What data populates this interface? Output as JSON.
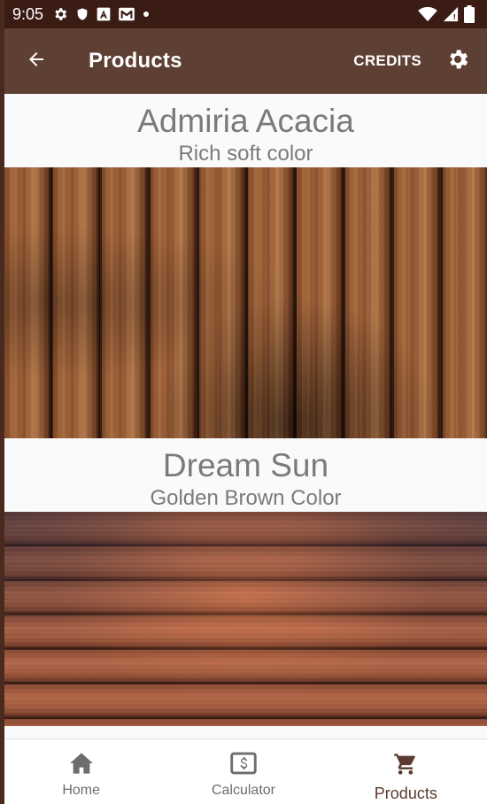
{
  "status_bar": {
    "time": "9:05",
    "icons_left": [
      "gear-icon",
      "shield-icon",
      "a-icon",
      "gmail-icon",
      "dot-icon"
    ],
    "icons_right": [
      "wifi-icon",
      "signal-icon",
      "battery-icon"
    ]
  },
  "app_bar": {
    "title": "Products",
    "credits_label": "CREDITS",
    "back_icon": "arrow-back-icon",
    "settings_icon": "gear-icon"
  },
  "products": [
    {
      "name": "Admiria Acacia",
      "description": "Rich soft color"
    },
    {
      "name": "Dream Sun",
      "description": "Golden Brown Color"
    }
  ],
  "bottom_nav": {
    "items": [
      {
        "label": "Home",
        "icon": "home-icon",
        "active": false
      },
      {
        "label": "Calculator",
        "icon": "dollar-card-icon",
        "active": false
      },
      {
        "label": "Products",
        "icon": "cart-icon",
        "active": true
      }
    ]
  },
  "colors": {
    "status_bar": "#3b1c15",
    "app_bar": "#5e3f33",
    "active_nav": "#5b3a2f",
    "inactive_nav": "#6d6d6d",
    "product_text": "#7a7a7a"
  }
}
